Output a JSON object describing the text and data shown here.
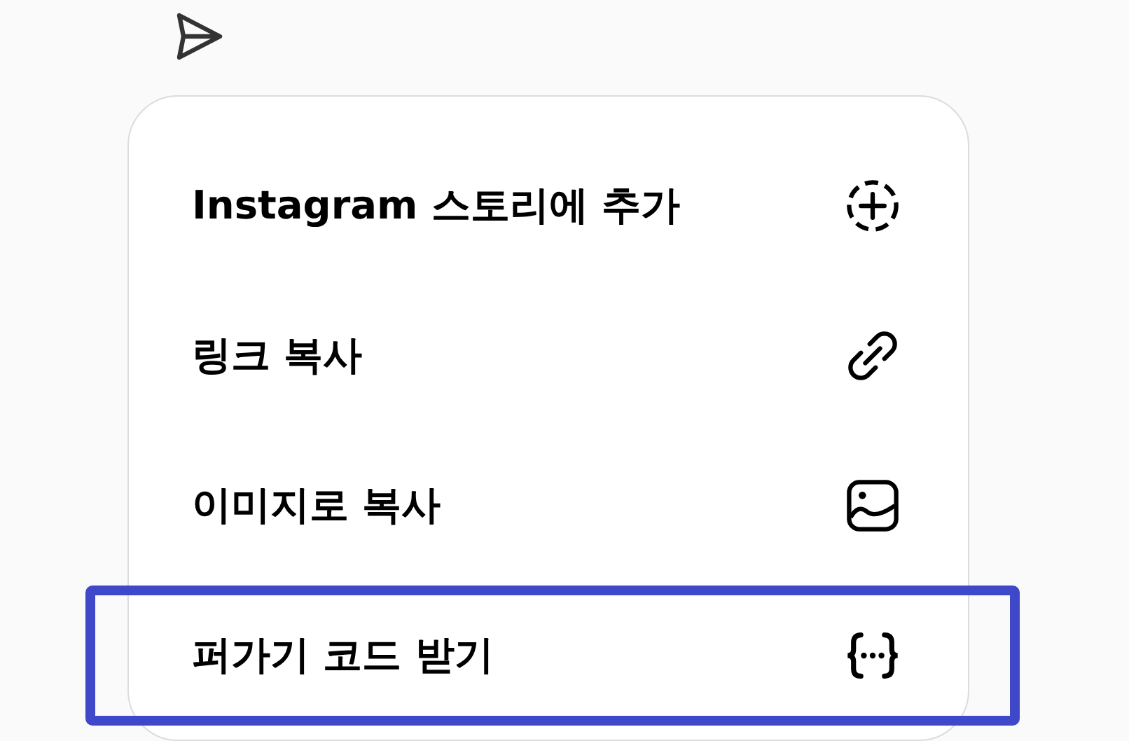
{
  "menu": {
    "items": [
      {
        "label": "Instagram 스토리에 추가",
        "selected": false
      },
      {
        "label": "링크 복사",
        "selected": false
      },
      {
        "label": "이미지로 복사",
        "selected": false
      },
      {
        "label": "퍼가기 코드 받기",
        "selected": true
      }
    ]
  }
}
